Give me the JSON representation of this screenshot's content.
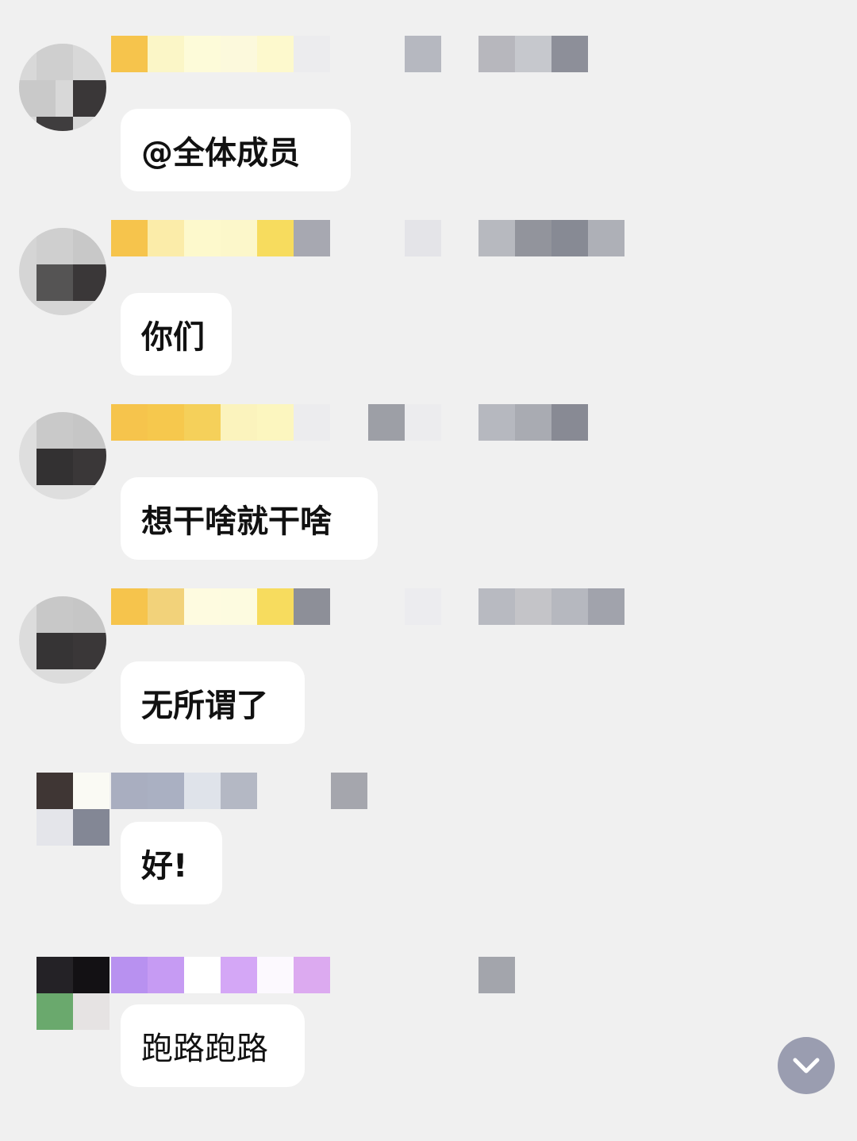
{
  "messages": [
    {
      "text": "@全体成员"
    },
    {
      "text": "你们"
    },
    {
      "text": "想干啥就干啥"
    },
    {
      "text": "无所谓了"
    },
    {
      "text": "好!"
    },
    {
      "text": "跑路跑路"
    }
  ],
  "icons": {
    "scroll_down": "chevron-down-icon"
  },
  "colors": {
    "background": "#f0f0f0",
    "bubble": "#ffffff",
    "scroll_button": "#9a9db0"
  }
}
